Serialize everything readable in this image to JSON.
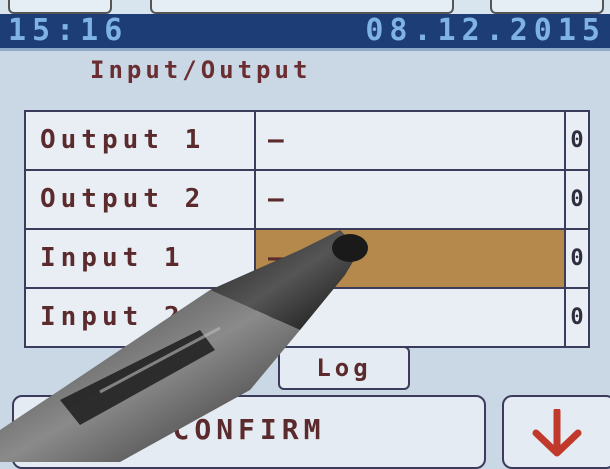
{
  "status": {
    "time": "15:16",
    "date": "08.12.2015"
  },
  "screen": {
    "title": "Input/Output"
  },
  "rows": [
    {
      "label": "Output 1",
      "value": "—",
      "number": "0"
    },
    {
      "label": "Output 2",
      "value": "—",
      "number": "0"
    },
    {
      "label": "Input 1",
      "value": "—",
      "number": "0"
    },
    {
      "label": "Input 2",
      "value": "—",
      "number": "0"
    }
  ],
  "buttons": {
    "log": "Log",
    "confirm": "CONFIRM"
  },
  "colors": {
    "selected_row": "#b5894b",
    "status_bar": "#1d3d76",
    "arrow": "#c0392b"
  },
  "icons": {
    "up": "arrow-up-icon",
    "down": "arrow-down-icon"
  }
}
